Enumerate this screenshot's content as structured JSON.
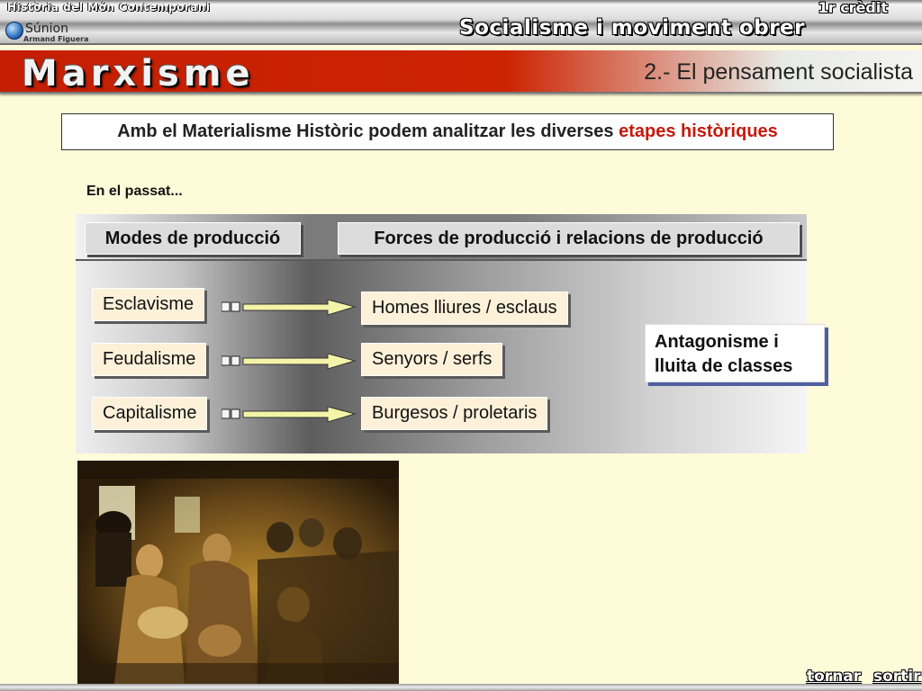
{
  "header": {
    "course_title": "Història del Món Contemporani",
    "credit": "1r crèdit",
    "unit_title": "Socialisme i moviment obrer",
    "logo": {
      "name": "Súnion",
      "author": "Armand Figuera"
    }
  },
  "banner": {
    "section_title": "Marxisme",
    "subtitle": "2.- El pensament socialista"
  },
  "statement": {
    "text": "Amb el Materialisme Històric podem analitzar les diverses",
    "highlight": "etapes històriques",
    "highlight_color": "#c41a0c"
  },
  "past_label": "En el passat...",
  "diagram": {
    "modes_header": "Modes de producció",
    "forces_header": "Forces de producció i relacions de producció",
    "rows": [
      {
        "mode": "Esclavisme",
        "relation": "Homes lliures / esclaus"
      },
      {
        "mode": "Feudalisme",
        "relation": "Senyors / serfs"
      },
      {
        "mode": "Capitalisme",
        "relation": "Burgesos / proletaris"
      }
    ],
    "conclusion_line1": "Antagonisme i",
    "conclusion_line2": "lluita de classes"
  },
  "image": {
    "subject": "painting of third-class railway carriage passengers"
  },
  "footer": {
    "back": "tornar",
    "exit": "sortir"
  },
  "colors": {
    "red_band": "#c51e02",
    "background": "#fefbd9",
    "chip": "#fdf1da"
  }
}
